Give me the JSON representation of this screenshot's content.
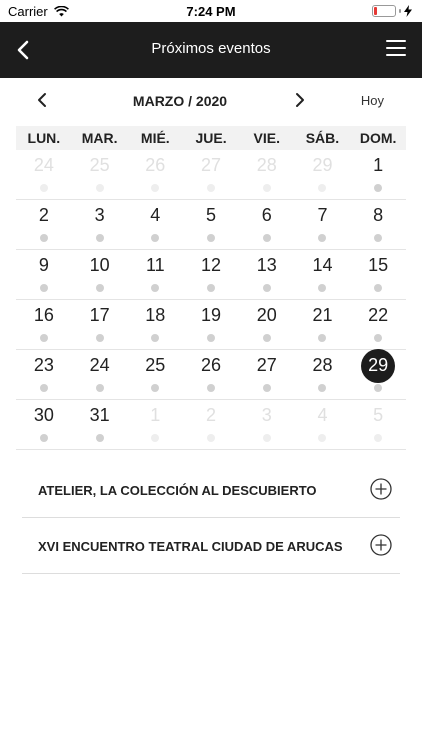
{
  "status_bar": {
    "carrier": "Carrier",
    "time": "7:24 PM"
  },
  "navbar": {
    "title": "Próximos eventos",
    "icons": {
      "back": "chevron-left-icon",
      "menu": "hamburger-menu-icon"
    }
  },
  "calendar": {
    "month_label": "MARZO / 2020",
    "today_label": "Hoy",
    "weekdays": [
      "LUN.",
      "MAR.",
      "MIÉ.",
      "JUE.",
      "VIE.",
      "SÁB.",
      "DOM."
    ],
    "selected_day": "29",
    "weeks": [
      [
        {
          "n": "24",
          "m": true
        },
        {
          "n": "25",
          "m": true
        },
        {
          "n": "26",
          "m": true
        },
        {
          "n": "27",
          "m": true
        },
        {
          "n": "28",
          "m": true
        },
        {
          "n": "29",
          "m": true
        },
        {
          "n": "1",
          "m": false
        }
      ],
      [
        {
          "n": "2",
          "m": false
        },
        {
          "n": "3",
          "m": false
        },
        {
          "n": "4",
          "m": false
        },
        {
          "n": "5",
          "m": false
        },
        {
          "n": "6",
          "m": false
        },
        {
          "n": "7",
          "m": false
        },
        {
          "n": "8",
          "m": false
        }
      ],
      [
        {
          "n": "9",
          "m": false
        },
        {
          "n": "10",
          "m": false
        },
        {
          "n": "11",
          "m": false
        },
        {
          "n": "12",
          "m": false
        },
        {
          "n": "13",
          "m": false
        },
        {
          "n": "14",
          "m": false
        },
        {
          "n": "15",
          "m": false
        }
      ],
      [
        {
          "n": "16",
          "m": false
        },
        {
          "n": "17",
          "m": false
        },
        {
          "n": "18",
          "m": false
        },
        {
          "n": "19",
          "m": false
        },
        {
          "n": "20",
          "m": false
        },
        {
          "n": "21",
          "m": false
        },
        {
          "n": "22",
          "m": false
        }
      ],
      [
        {
          "n": "23",
          "m": false
        },
        {
          "n": "24",
          "m": false
        },
        {
          "n": "25",
          "m": false
        },
        {
          "n": "26",
          "m": false
        },
        {
          "n": "27",
          "m": false
        },
        {
          "n": "28",
          "m": false
        },
        {
          "n": "29",
          "m": false
        }
      ],
      [
        {
          "n": "30",
          "m": false
        },
        {
          "n": "31",
          "m": false
        },
        {
          "n": "1",
          "m": true
        },
        {
          "n": "2",
          "m": true
        },
        {
          "n": "3",
          "m": true
        },
        {
          "n": "4",
          "m": true
        },
        {
          "n": "5",
          "m": true
        }
      ]
    ]
  },
  "events": [
    {
      "title": "ATELIER, LA COLECCIÓN AL DESCUBIERTO"
    },
    {
      "title": "XVI ENCUENTRO TEATRAL CIUDAD DE ARUCAS"
    }
  ],
  "colors": {
    "navbar": "#1d1d1d",
    "selected": "#1d1d1d",
    "battery_low": "#e53935"
  }
}
